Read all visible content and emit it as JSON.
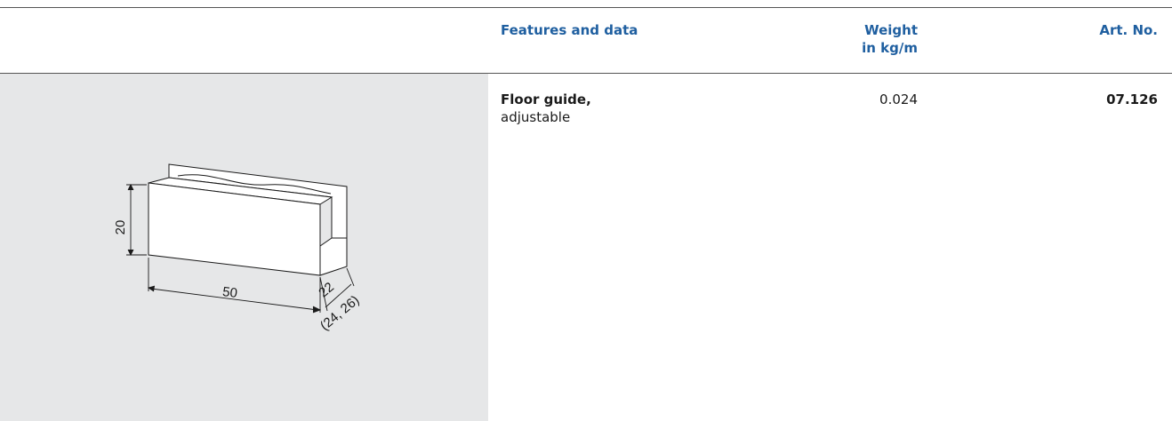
{
  "table": {
    "headers": {
      "features": "Features and data",
      "weight_line1": "Weight",
      "weight_line2": "in kg/m",
      "art_no": "Art. No."
    },
    "rows": [
      {
        "name": "Floor guide,",
        "description": "adjustable",
        "weight": "0.024",
        "art_no": "07.126"
      }
    ]
  },
  "drawing": {
    "dim_height": "20",
    "dim_length": "50",
    "dim_width": "22",
    "dim_width_alt": "(24, 26)"
  },
  "colors": {
    "header_text": "#1f5fa0",
    "panel_bg": "#e6e7e8",
    "rule": "#555555"
  }
}
